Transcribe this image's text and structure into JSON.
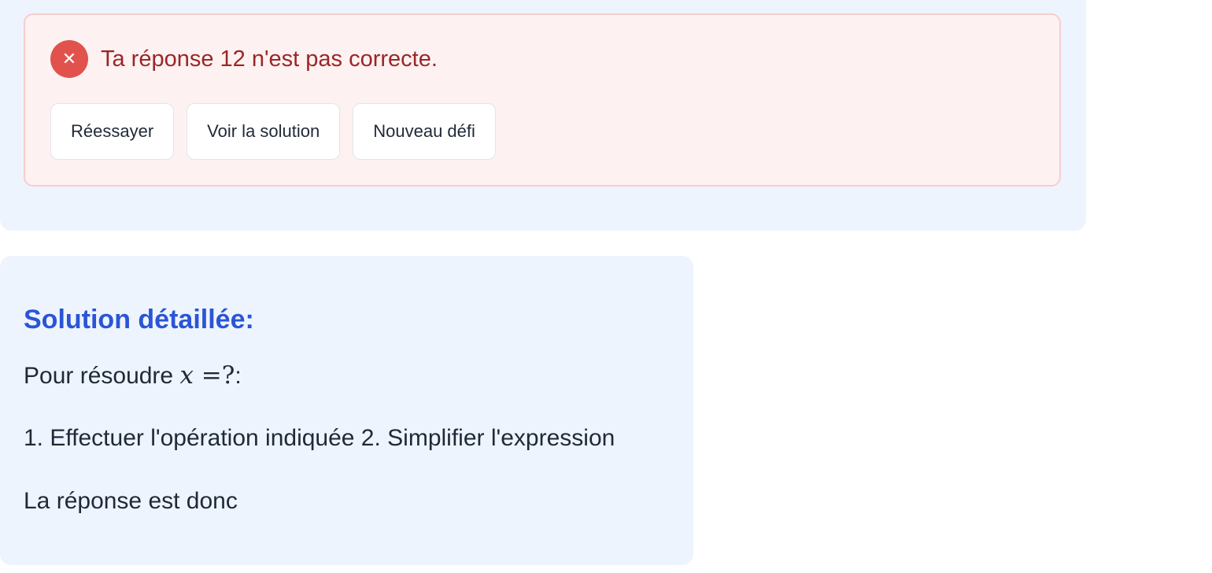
{
  "feedback": {
    "icon": "close-icon",
    "message": "Ta réponse 12 n'est pas correcte.",
    "colors": {
      "background": "#fdf1f1",
      "border": "#f7cdcd",
      "icon": "#e2524c",
      "text": "#9b2626"
    },
    "buttons": {
      "retry": "Réessayer",
      "show_solution": "Voir la solution",
      "new_challenge": "Nouveau défi"
    }
  },
  "solution": {
    "title": "Solution détaillée:",
    "intro_prefix": "Pour résoudre ",
    "math_var": "x",
    "math_rest": " =?",
    "intro_suffix": ":",
    "steps": "1. Effectuer l'opération indiquée 2. Simplifier l'expression",
    "conclusion": "La réponse est donc",
    "colors": {
      "title": "#2a55d6",
      "card_background": "#eef4fd"
    }
  }
}
